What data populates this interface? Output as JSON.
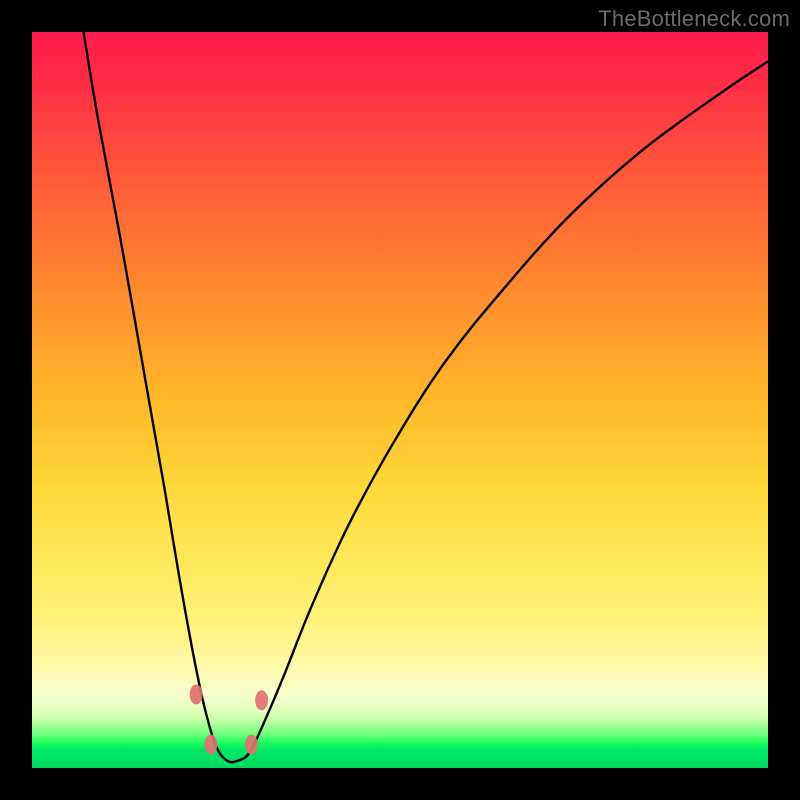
{
  "watermark": {
    "text": "TheBottleneck.com"
  },
  "chart_data": {
    "type": "line",
    "title": "",
    "xlabel": "",
    "ylabel": "",
    "xlim": [
      0,
      100
    ],
    "ylim": [
      0,
      100
    ],
    "series": [
      {
        "name": "bottleneck-curve",
        "x": [
          7,
          9,
          12,
          15,
          18,
          20,
          22,
          23.5,
          25,
          26.5,
          28,
          29.5,
          31,
          34,
          38,
          43,
          49,
          56,
          64,
          73,
          83,
          94,
          100
        ],
        "y": [
          100,
          88,
          72,
          55,
          38,
          26,
          15,
          8,
          3,
          1,
          1,
          2,
          5,
          12,
          22,
          33,
          44,
          55,
          65,
          75,
          84,
          92,
          96
        ]
      }
    ],
    "markers": [
      {
        "name": "marker-left-upper",
        "x": 22.3,
        "y": 10,
        "r": 1.6
      },
      {
        "name": "marker-left-lower",
        "x": 24.3,
        "y": 3.2,
        "r": 1.6
      },
      {
        "name": "marker-right-lower",
        "x": 29.8,
        "y": 3.2,
        "r": 1.6
      },
      {
        "name": "marker-right-upper",
        "x": 31.2,
        "y": 9.2,
        "r": 1.6
      }
    ],
    "marker_color": "#e0726e",
    "gradient_stops": [
      {
        "pos": 0,
        "color": "#ff1a4d"
      },
      {
        "pos": 0.35,
        "color": "#ff8a2e"
      },
      {
        "pos": 0.72,
        "color": "#ffe75a"
      },
      {
        "pos": 0.9,
        "color": "#f8ffd0"
      },
      {
        "pos": 0.96,
        "color": "#1fff61"
      },
      {
        "pos": 1.0,
        "color": "#00d860"
      }
    ]
  }
}
